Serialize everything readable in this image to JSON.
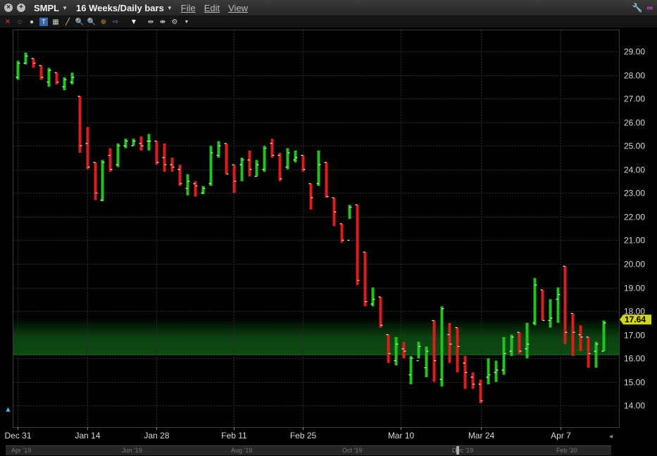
{
  "titlebar": {
    "symbol": "SMPL",
    "timeframe": "16 Weeks/Daily bars",
    "menus": [
      "File",
      "Edit",
      "View"
    ]
  },
  "price_label": "17.64",
  "colors": {
    "up": "#21c21c",
    "down": "#e01b1b",
    "price_tag": "#cfd61a",
    "band": "#0c4a12"
  },
  "scrollbar": {
    "labels": [
      "Apr '19",
      "Jun '19",
      "Aug '19",
      "Oct '19",
      "Dec '19",
      "Feb '20"
    ]
  },
  "chart_data": {
    "type": "ohlc",
    "x_tick_labels": [
      "Dec 31",
      "Jan 14",
      "Jan 28",
      "Feb 11",
      "Feb 25",
      "Mar 10",
      "Mar 24",
      "Apr 7"
    ],
    "y_ticks": [
      14,
      15,
      16,
      17,
      18,
      19,
      20,
      21,
      22,
      23,
      24,
      25,
      26,
      27,
      28,
      29
    ],
    "y_tick_labels": [
      "14.00",
      "15.00",
      "16.00",
      "17.00",
      "18.00",
      "19.00",
      "20.00",
      "21.00",
      "22.00",
      "23.00",
      "24.00",
      "25.00",
      "26.00",
      "27.00",
      "28.00",
      "29.00"
    ],
    "ylim": [
      13.0,
      30.0
    ],
    "band": [
      16.15,
      17.0
    ],
    "last_price": 17.64,
    "grid": true,
    "bars": [
      {
        "d": "Dec 31",
        "o": 27.9,
        "h": 28.6,
        "l": 27.8,
        "c": 28.5
      },
      {
        "d": "Jan 2",
        "o": 28.5,
        "h": 28.95,
        "l": 28.45,
        "c": 28.8
      },
      {
        "d": "Jan 3",
        "o": 28.7,
        "h": 28.7,
        "l": 28.3,
        "c": 28.5
      },
      {
        "d": "Jan 4",
        "o": 28.4,
        "h": 28.4,
        "l": 27.8,
        "c": 27.9
      },
      {
        "d": "Jan 7",
        "o": 27.7,
        "h": 28.3,
        "l": 27.5,
        "c": 28.2
      },
      {
        "d": "Jan 8",
        "o": 28.1,
        "h": 28.1,
        "l": 27.6,
        "c": 27.7
      },
      {
        "d": "Jan 9",
        "o": 27.5,
        "h": 27.9,
        "l": 27.35,
        "c": 27.8
      },
      {
        "d": "Jan 10",
        "o": 27.7,
        "h": 28.1,
        "l": 27.6,
        "c": 27.9
      },
      {
        "d": "Jan 11",
        "o": 27.1,
        "h": 27.1,
        "l": 24.7,
        "c": 25.0
      },
      {
        "d": "Jan 14",
        "o": 25.1,
        "h": 25.8,
        "l": 24.0,
        "c": 24.1
      },
      {
        "d": "Jan 15",
        "o": 24.3,
        "h": 24.3,
        "l": 22.7,
        "c": 23.0
      },
      {
        "d": "Jan 16",
        "o": 22.7,
        "h": 24.4,
        "l": 22.65,
        "c": 24.3
      },
      {
        "d": "Jan 17",
        "o": 24.6,
        "h": 24.9,
        "l": 23.9,
        "c": 24.0
      },
      {
        "d": "Jan 18",
        "o": 24.2,
        "h": 25.1,
        "l": 24.1,
        "c": 25.0
      },
      {
        "d": "Jan 22",
        "o": 25.0,
        "h": 25.3,
        "l": 24.9,
        "c": 25.2
      },
      {
        "d": "Jan 23",
        "o": 25.0,
        "h": 25.3,
        "l": 25.0,
        "c": 25.2
      },
      {
        "d": "Jan 24",
        "o": 25.1,
        "h": 25.4,
        "l": 24.8,
        "c": 25.0
      },
      {
        "d": "Jan 25",
        "o": 25.2,
        "h": 25.5,
        "l": 24.8,
        "c": 25.2
      },
      {
        "d": "Jan 28",
        "o": 25.2,
        "h": 25.2,
        "l": 24.2,
        "c": 24.3
      },
      {
        "d": "Jan 29",
        "o": 24.5,
        "h": 25.1,
        "l": 23.9,
        "c": 24.2
      },
      {
        "d": "Jan 30",
        "o": 24.2,
        "h": 24.5,
        "l": 23.9,
        "c": 24.1
      },
      {
        "d": "Jan 31",
        "o": 24.0,
        "h": 24.2,
        "l": 23.3,
        "c": 23.4
      },
      {
        "d": "Feb 1",
        "o": 23.2,
        "h": 23.8,
        "l": 22.9,
        "c": 23.5
      },
      {
        "d": "Feb 4",
        "o": 23.4,
        "h": 23.5,
        "l": 22.85,
        "c": 23.3
      },
      {
        "d": "Feb 5",
        "o": 23.0,
        "h": 23.3,
        "l": 22.95,
        "c": 23.2
      },
      {
        "d": "Feb 6",
        "o": 23.4,
        "h": 25.0,
        "l": 23.3,
        "c": 24.7
      },
      {
        "d": "Feb 7",
        "o": 24.6,
        "h": 25.2,
        "l": 24.5,
        "c": 25.0
      },
      {
        "d": "Feb 8",
        "o": 25.1,
        "h": 25.1,
        "l": 23.8,
        "c": 23.8
      },
      {
        "d": "Feb 11",
        "o": 24.2,
        "h": 24.2,
        "l": 23.0,
        "c": 23.5
      },
      {
        "d": "Feb 12",
        "o": 24.2,
        "h": 24.5,
        "l": 23.5,
        "c": 24.4
      },
      {
        "d": "Feb 13",
        "o": 24.4,
        "h": 24.8,
        "l": 23.7,
        "c": 24.0
      },
      {
        "d": "Feb 14",
        "o": 23.7,
        "h": 24.4,
        "l": 23.7,
        "c": 24.2
      },
      {
        "d": "Feb 15",
        "o": 24.0,
        "h": 25.0,
        "l": 23.9,
        "c": 24.9
      },
      {
        "d": "Feb 19",
        "o": 25.1,
        "h": 25.3,
        "l": 24.5,
        "c": 24.6
      },
      {
        "d": "Feb 20",
        "o": 24.6,
        "h": 24.7,
        "l": 23.5,
        "c": 23.6
      },
      {
        "d": "Feb 21",
        "o": 24.1,
        "h": 24.9,
        "l": 24.0,
        "c": 24.7
      },
      {
        "d": "Feb 22",
        "o": 24.4,
        "h": 24.8,
        "l": 24.3,
        "c": 24.5
      },
      {
        "d": "Feb 25",
        "o": 24.6,
        "h": 24.6,
        "l": 23.9,
        "c": 24.0
      },
      {
        "d": "Feb 26",
        "o": 23.4,
        "h": 23.4,
        "l": 22.3,
        "c": 22.8
      },
      {
        "d": "Feb 27",
        "o": 23.4,
        "h": 24.8,
        "l": 23.3,
        "c": 24.2
      },
      {
        "d": "Feb 28",
        "o": 24.3,
        "h": 24.3,
        "l": 22.8,
        "c": 22.85
      },
      {
        "d": "Mar 1",
        "o": 22.8,
        "h": 22.8,
        "l": 21.6,
        "c": 22.2
      },
      {
        "d": "Mar 4",
        "o": 21.7,
        "h": 21.7,
        "l": 20.9,
        "c": 21.0
      },
      {
        "d": "Mar 5",
        "o": 21.0,
        "h": 22.5,
        "l": 21.9,
        "c": 22.4
      },
      {
        "d": "Mar 6",
        "o": 22.5,
        "h": 22.5,
        "l": 19.1,
        "c": 19.3
      },
      {
        "d": "Mar 7",
        "o": 20.5,
        "h": 20.5,
        "l": 18.2,
        "c": 18.4
      },
      {
        "d": "Mar 8",
        "o": 18.3,
        "h": 19.0,
        "l": 18.2,
        "c": 18.5
      },
      {
        "d": "Mar 11",
        "o": 18.6,
        "h": 18.6,
        "l": 17.3,
        "c": 17.4
      },
      {
        "d": "Mar 12",
        "o": 17.0,
        "h": 17.0,
        "l": 15.8,
        "c": 16.2
      },
      {
        "d": "Mar 13",
        "o": 15.9,
        "h": 16.9,
        "l": 15.7,
        "c": 16.6
      },
      {
        "d": "Mar 14",
        "o": 16.4,
        "h": 16.7,
        "l": 16.0,
        "c": 16.3
      },
      {
        "d": "Mar 15",
        "o": 15.3,
        "h": 16.1,
        "l": 14.9,
        "c": 16.0
      },
      {
        "d": "Mar 18",
        "o": 15.9,
        "h": 16.7,
        "l": 16.0,
        "c": 16.5
      },
      {
        "d": "Mar 19",
        "o": 15.6,
        "h": 16.5,
        "l": 15.2,
        "c": 16.3
      },
      {
        "d": "Mar 20",
        "o": 17.6,
        "h": 17.6,
        "l": 15.0,
        "c": 15.9
      },
      {
        "d": "Mar 21",
        "o": 15.1,
        "h": 18.2,
        "l": 14.8,
        "c": 18.1
      },
      {
        "d": "Mar 22",
        "o": 17.0,
        "h": 17.5,
        "l": 15.8,
        "c": 16.6
      },
      {
        "d": "Mar 25",
        "o": 17.3,
        "h": 17.3,
        "l": 15.4,
        "c": 16.5
      },
      {
        "d": "Mar 26",
        "o": 15.8,
        "h": 16.1,
        "l": 14.7,
        "c": 15.4
      },
      {
        "d": "Mar 27",
        "o": 15.2,
        "h": 15.4,
        "l": 14.7,
        "c": 14.9
      },
      {
        "d": "Mar 28",
        "o": 14.9,
        "h": 15.1,
        "l": 14.1,
        "c": 14.2
      },
      {
        "d": "Mar 29",
        "o": 15.2,
        "h": 16.0,
        "l": 14.9,
        "c": 15.3
      },
      {
        "d": "Apr 1",
        "o": 15.4,
        "h": 15.9,
        "l": 15.0,
        "c": 15.5
      },
      {
        "d": "Apr 2",
        "o": 15.5,
        "h": 16.9,
        "l": 15.3,
        "c": 16.2
      },
      {
        "d": "Apr 3",
        "o": 16.3,
        "h": 17.0,
        "l": 16.1,
        "c": 16.9
      },
      {
        "d": "Apr 4",
        "o": 17.1,
        "h": 17.1,
        "l": 16.2,
        "c": 16.3
      },
      {
        "d": "Apr 5",
        "o": 16.4,
        "h": 17.5,
        "l": 16.0,
        "c": 16.6
      },
      {
        "d": "Apr 8",
        "o": 17.5,
        "h": 19.4,
        "l": 17.4,
        "c": 19.1
      },
      {
        "d": "Apr 9",
        "o": 18.9,
        "h": 18.9,
        "l": 17.6,
        "c": 17.6
      },
      {
        "d": "Apr 10",
        "o": 17.6,
        "h": 18.5,
        "l": 17.3,
        "c": 17.7
      },
      {
        "d": "Apr 11",
        "o": 18.5,
        "h": 19.0,
        "l": 17.5,
        "c": 18.7
      },
      {
        "d": "Apr 12",
        "o": 19.9,
        "h": 19.9,
        "l": 16.6,
        "c": 17.1
      },
      {
        "d": "Apr 15",
        "o": 17.9,
        "h": 17.9,
        "l": 16.1,
        "c": 17.1
      },
      {
        "d": "Apr 16",
        "o": 17.0,
        "h": 17.4,
        "l": 16.3,
        "c": 16.9
      },
      {
        "d": "Apr 17",
        "o": 16.9,
        "h": 16.9,
        "l": 15.6,
        "c": 16.2
      },
      {
        "d": "Apr 18",
        "o": 16.3,
        "h": 16.7,
        "l": 15.6,
        "c": 16.6
      },
      {
        "d": "Apr 19",
        "o": 16.3,
        "h": 17.6,
        "l": 16.3,
        "c": 17.5
      }
    ]
  }
}
